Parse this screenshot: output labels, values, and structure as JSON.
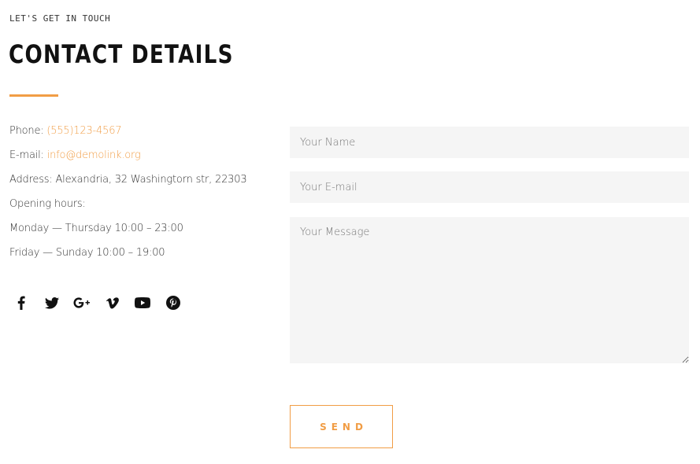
{
  "header": {
    "eyebrow": "LET'S GET IN TOUCH",
    "title": "CONTACT DETAILS"
  },
  "contact": {
    "phone_label": "Phone: ",
    "phone_value": "(555)123-4567",
    "email_label": "E-mail: ",
    "email_value": "info@demolink.org",
    "address": "Address: Alexandria, 32 Washingtorn str, 22303",
    "hours_label": "Opening hours:",
    "hours_weekdays": "Monday — Thursday 10:00 – 23:00",
    "hours_weekend": "Friday — Sunday 10:00 – 19:00"
  },
  "social": {
    "icons": [
      "facebook-icon",
      "twitter-icon",
      "google-plus-icon",
      "vimeo-icon",
      "youtube-icon",
      "pinterest-icon"
    ]
  },
  "form": {
    "name_placeholder": "Your Name",
    "email_placeholder": "Your E-mail",
    "message_placeholder": "Your Message",
    "send_label": "SEND"
  },
  "colors": {
    "accent": "#f19d45",
    "field_background": "#f5f5f5",
    "text": "#333333",
    "heading": "#111111"
  }
}
